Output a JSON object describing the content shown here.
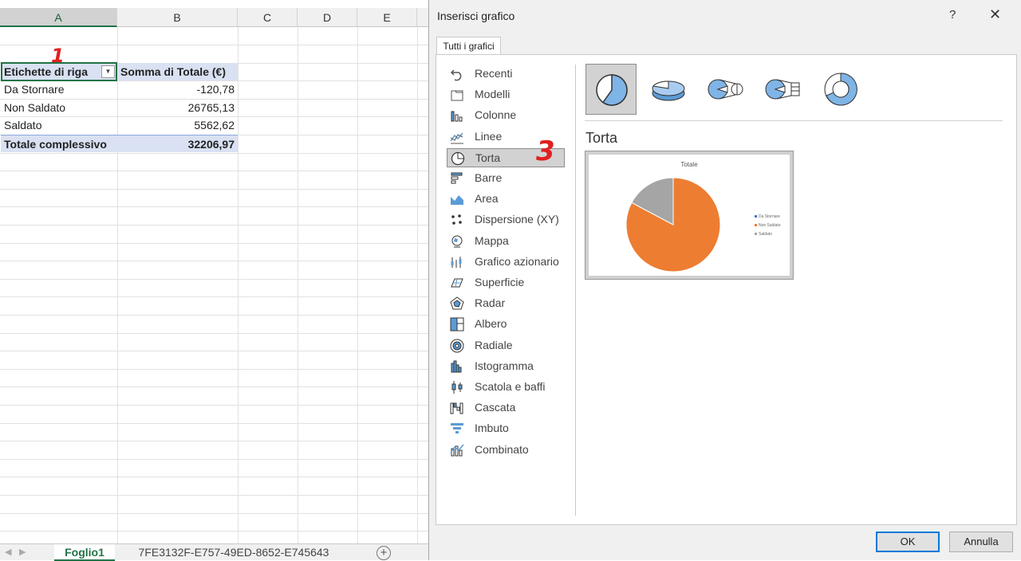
{
  "sheet": {
    "columns": [
      "A",
      "B",
      "C",
      "D",
      "E"
    ],
    "pivot": {
      "header_label": "Etichette di riga",
      "header_value": "Somma di Totale (€)",
      "rows": [
        {
          "label": "Da Stornare",
          "value": "-120,78"
        },
        {
          "label": "Non Saldato",
          "value": "26765,13"
        },
        {
          "label": "Saldato",
          "value": "5562,62"
        }
      ],
      "total_label": "Totale complessivo",
      "total_value": "32206,97"
    },
    "annotations": [
      "1",
      "3"
    ],
    "tabs": {
      "active": "Foglio1",
      "other": "7FE3132F-E757-49ED-8652-E745643",
      "add": "+"
    }
  },
  "dialog": {
    "title": "Inserisci grafico",
    "help": "?",
    "close": "✕",
    "tab": "Tutti i grafici",
    "chart_types": [
      {
        "label": "Recenti",
        "icon": "recent-icon"
      },
      {
        "label": "Modelli",
        "icon": "folder-icon"
      },
      {
        "label": "Colonne",
        "icon": "column-chart-icon"
      },
      {
        "label": "Linee",
        "icon": "line-chart-icon"
      },
      {
        "label": "Torta",
        "icon": "pie-chart-icon",
        "selected": true
      },
      {
        "label": "Barre",
        "icon": "bar-chart-icon"
      },
      {
        "label": "Area",
        "icon": "area-chart-icon"
      },
      {
        "label": "Dispersione (XY)",
        "icon": "scatter-chart-icon"
      },
      {
        "label": "Mappa",
        "icon": "map-chart-icon"
      },
      {
        "label": "Grafico azionario",
        "icon": "stock-chart-icon"
      },
      {
        "label": "Superficie",
        "icon": "surface-chart-icon"
      },
      {
        "label": "Radar",
        "icon": "radar-chart-icon"
      },
      {
        "label": "Albero",
        "icon": "treemap-chart-icon"
      },
      {
        "label": "Radiale",
        "icon": "sunburst-chart-icon"
      },
      {
        "label": "Istogramma",
        "icon": "histogram-chart-icon"
      },
      {
        "label": "Scatola e baffi",
        "icon": "box-whisker-chart-icon"
      },
      {
        "label": "Cascata",
        "icon": "waterfall-chart-icon"
      },
      {
        "label": "Imbuto",
        "icon": "funnel-chart-icon"
      },
      {
        "label": "Combinato",
        "icon": "combo-chart-icon"
      }
    ],
    "subtypes": [
      "pie-icon",
      "pie-3d-icon",
      "pie-of-pie-icon",
      "bar-of-pie-icon",
      "doughnut-icon"
    ],
    "selected_type_title": "Torta",
    "ok_label": "OK",
    "cancel_label": "Annulla",
    "accent_color": "#0078d7"
  },
  "chart_data": {
    "type": "pie",
    "title": "Totale",
    "categories": [
      "Da Stornare",
      "Non Saldato",
      "Saldato"
    ],
    "values": [
      0,
      26765.13,
      5562.62
    ],
    "colors": [
      "#4472c4",
      "#ed7d31",
      "#a5a5a5"
    ],
    "legend": "right"
  }
}
